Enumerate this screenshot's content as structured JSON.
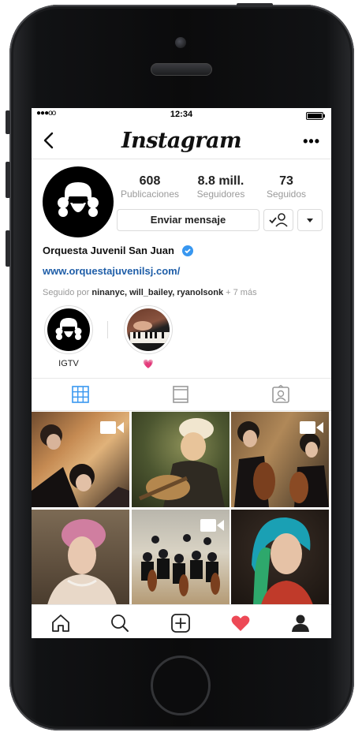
{
  "status_bar": {
    "signal": "●●●oo",
    "time": "12:34"
  },
  "header": {
    "title": "Instagram",
    "more_label": "•••"
  },
  "profile": {
    "stats": [
      {
        "value": "608",
        "label": "Publicaciones"
      },
      {
        "value": "8.8 mill.",
        "label": "Seguidores"
      },
      {
        "value": "73",
        "label": "Seguidos"
      }
    ],
    "message_button": "Enviar mensaje",
    "name": "Orquesta Juvenil San Juan",
    "website": "www.orquestajuvenilsj.com/",
    "followed_by_prefix": "Seguido por",
    "followed_by_names": "ninanyc, will_bailey, ryanolsonk",
    "followed_by_suffix": "+ 7 más"
  },
  "highlights": [
    {
      "label": "IGTV"
    },
    {
      "label": "💗"
    }
  ],
  "tabs": [
    "grid-icon",
    "feed-icon",
    "tagged-icon"
  ],
  "grid": [
    {
      "desc": "violinists",
      "video": true
    },
    {
      "desc": "painting-lute",
      "video": false
    },
    {
      "desc": "cellists",
      "video": true
    },
    {
      "desc": "painting-pink-hair",
      "video": false
    },
    {
      "desc": "orchestra",
      "video": true
    },
    {
      "desc": "painting-blue-hair",
      "video": false
    }
  ],
  "bottom_nav": [
    "home-icon",
    "search-icon",
    "add-icon",
    "heart-icon",
    "profile-icon"
  ],
  "colors": {
    "accent": "#3897f0",
    "link": "#1f5ea8",
    "heart": "#ed4956"
  }
}
